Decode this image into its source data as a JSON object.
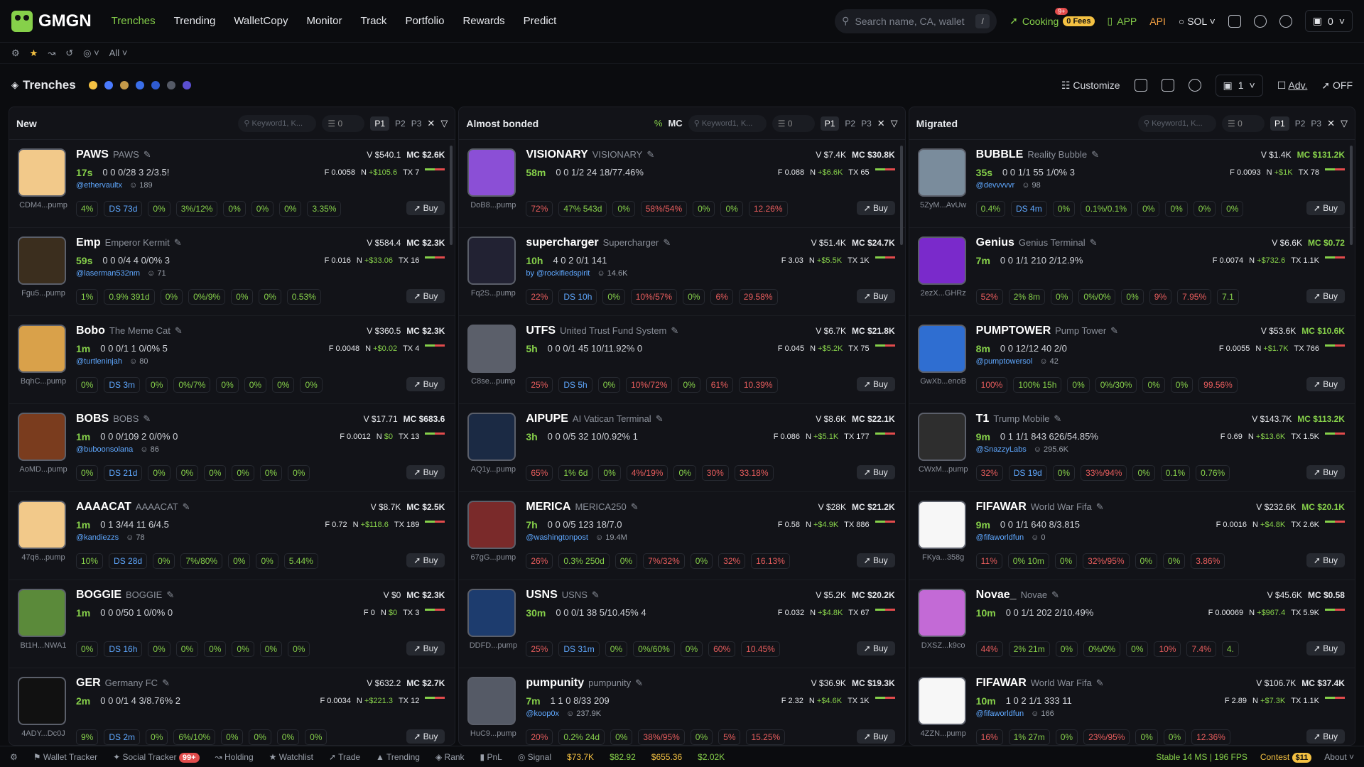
{
  "nav": {
    "brand": "GMGN",
    "items": [
      "Trenches",
      "Trending",
      "WalletCopy",
      "Monitor",
      "Track",
      "Portfolio",
      "Rewards",
      "Predict"
    ],
    "search_placeholder": "Search name, CA, wallet",
    "slash": "/",
    "cooking": "Cooking",
    "cooking_badge": "9+",
    "fees": "0 Fees",
    "app": "APP",
    "api": "API",
    "chain": "SOL",
    "wallet_val": "0"
  },
  "sub": {
    "filter": "All"
  },
  "header": {
    "title": "Trenches",
    "customize": "Customize",
    "count": "1",
    "adv": "Adv.",
    "off": "OFF"
  },
  "columns": [
    {
      "name": "New",
      "pct": "",
      "mc": ""
    },
    {
      "name": "Almost bonded",
      "pct": "%",
      "mc": "MC"
    },
    {
      "name": "Migrated",
      "pct": "",
      "mc": ""
    }
  ],
  "col_common": {
    "keyword": "Keyword1, K...",
    "zero": "0",
    "p1": "P1",
    "p2": "P2",
    "p3": "P3",
    "buy": "Buy"
  },
  "cards": [
    [
      {
        "sym": "PAWS",
        "name": "PAWS",
        "v": "$540.1",
        "mc": "$2.6K",
        "age": "17s",
        "stats": "0  0  0/28  3  2/3.5!",
        "fval": "0.0058",
        "n": "+$105.6",
        "tx": "7",
        "handle": "@ethervaultx",
        "fol": "189",
        "ca": "CDM4...pump",
        "p": [
          "4%",
          "DS 73d",
          "0%",
          "3%/12%",
          "0%",
          "0%",
          "0%",
          "3.35%"
        ]
      },
      {
        "sym": "Emp",
        "name": "Emperor Kermit",
        "v": "$584.4",
        "mc": "$2.3K",
        "age": "59s",
        "stats": "0  0  0/4  4  0/0%  3",
        "fval": "0.016",
        "n": "+$33.06",
        "tx": "16",
        "handle": "@laserman532nm",
        "fol": "71",
        "ca": "Fgu5...pump",
        "p": [
          "1%",
          "0.9% 391d",
          "0%",
          "0%/9%",
          "0%",
          "0%",
          "0.53%",
          ""
        ]
      },
      {
        "sym": "Bobo",
        "name": "The Meme Cat",
        "v": "$360.5",
        "mc": "$2.3K",
        "age": "1m",
        "stats": "0  0  0/1  1  0/0%  5",
        "fval": "0.0048",
        "n": "+$0.02",
        "tx": "4",
        "handle": "@turtleninjah",
        "fol": "80",
        "ca": "BqhC...pump",
        "p": [
          "0%",
          "DS 3m",
          "0%",
          "0%/7%",
          "0%",
          "0%",
          "0%",
          "0%"
        ]
      },
      {
        "sym": "BOBS",
        "name": "BOBS",
        "v": "$17.71",
        "mc": "$683.6",
        "age": "1m",
        "stats": "0  0  0/109  2  0/0%  0",
        "fval": "0.0012",
        "n": "$0",
        "tx": "13",
        "handle": "@buboonsolana",
        "fol": "86",
        "ca": "AoMD...pump",
        "p": [
          "0%",
          "DS 21d",
          "0%",
          "0%",
          "0%",
          "0%",
          "0%",
          "0%"
        ]
      },
      {
        "sym": "AAAACAT",
        "name": "AAAACAT",
        "v": "$8.7K",
        "mc": "$2.5K",
        "age": "1m",
        "stats": "0  1  3/44  11  6/4.5",
        "fval": "0.72",
        "n": "+$118.6",
        "tx": "189",
        "handle": "@kandiezzs",
        "fol": "78",
        "ca": "47q6...pump",
        "p": [
          "10%",
          "DS 28d",
          "0%",
          "7%/80%",
          "0%",
          "0%",
          "5.44%",
          ""
        ]
      },
      {
        "sym": "BOGGIE",
        "name": "BOGGIE",
        "v": "$0",
        "mc": "$2.3K",
        "age": "1m",
        "stats": "0  0  0/50  1  0/0%  0",
        "fval": "0",
        "n": "$0",
        "tx": "3",
        "handle": "",
        "fol": "",
        "ca": "Bt1H...NWA1",
        "p": [
          "0%",
          "DS 16h",
          "0%",
          "0%",
          "0%",
          "0%",
          "0%",
          "0%"
        ]
      },
      {
        "sym": "GER",
        "name": "Germany FC",
        "v": "$632.2",
        "mc": "$2.7K",
        "age": "2m",
        "stats": "0  0  0/1  4  3/8.76%  2",
        "fval": "0.0034",
        "n": "+$221.3",
        "tx": "12",
        "handle": "",
        "fol": "",
        "ca": "4ADY...Dc0J",
        "p": [
          "9%",
          "DS 2m",
          "0%",
          "6%/10%",
          "0%",
          "0%",
          "0%",
          "0%"
        ]
      }
    ],
    [
      {
        "sym": "VISIONARY",
        "name": "VISIONARY",
        "v": "$7.4K",
        "mc": "$30.8K",
        "age": "58m",
        "stats": "0  0  1/2  24  18/77.46%",
        "fval": "0.088",
        "n": "+$6.6K",
        "tx": "65",
        "handle": "",
        "fol": "",
        "ca": "DoB8...pump",
        "p": [
          "72%",
          "47% 543d",
          "0%",
          "58%/54%",
          "0%",
          "0%",
          "12.26%",
          ""
        ]
      },
      {
        "sym": "supercharger",
        "name": "Supercharger",
        "v": "$51.4K",
        "mc": "$24.7K",
        "age": "10h",
        "stats": "4  0  2  0/1  141",
        "fval": "3.03",
        "n": "+$5.5K",
        "tx": "1K",
        "handle": "by @rockifiedspirit",
        "fol": "14.6K",
        "ca": "Fq2S...pump",
        "p": [
          "22%",
          "DS 10h",
          "0%",
          "10%/57%",
          "0%",
          "6%",
          "29.58%",
          ""
        ]
      },
      {
        "sym": "UTFS",
        "name": "United Trust Fund System",
        "v": "$6.7K",
        "mc": "$21.8K",
        "age": "5h",
        "stats": "0  0  0/1  45  10/11.92%  0",
        "fval": "0.045",
        "n": "+$5.2K",
        "tx": "75",
        "handle": "",
        "fol": "",
        "ca": "C8se...pump",
        "p": [
          "25%",
          "DS 5h",
          "0%",
          "10%/72%",
          "0%",
          "61%",
          "10.39%",
          ""
        ]
      },
      {
        "sym": "AIPUPE",
        "name": "AI Vatican Terminal",
        "v": "$8.6K",
        "mc": "$22.1K",
        "age": "3h",
        "stats": "0  0  0/5  32  10/0.92%  1",
        "fval": "0.086",
        "n": "+$5.1K",
        "tx": "177",
        "handle": "",
        "fol": "",
        "ca": "AQ1y...pump",
        "p": [
          "65%",
          "1% 6d",
          "0%",
          "4%/19%",
          "0%",
          "30%",
          "33.18%",
          ""
        ]
      },
      {
        "sym": "MERICA",
        "name": "MERICA250",
        "v": "$28K",
        "mc": "$21.2K",
        "age": "7h",
        "stats": "0  0  0/5  123  18/7.0",
        "fval": "0.58",
        "n": "+$4.9K",
        "tx": "886",
        "handle": "@washingtonpost",
        "fol": "19.4M",
        "ca": "67gG...pump",
        "p": [
          "26%",
          "0.3% 250d",
          "0%",
          "7%/32%",
          "0%",
          "32%",
          "16.13%",
          ""
        ]
      },
      {
        "sym": "USNS",
        "name": "USNS",
        "v": "$5.2K",
        "mc": "$20.2K",
        "age": "30m",
        "stats": "0  0  0/1  38  5/10.45%  4",
        "fval": "0.032",
        "n": "+$4.8K",
        "tx": "67",
        "handle": "",
        "fol": "",
        "ca": "DDFD...pump",
        "p": [
          "25%",
          "DS 31m",
          "0%",
          "0%/60%",
          "0%",
          "60%",
          "10.45%",
          ""
        ]
      },
      {
        "sym": "pumpunity",
        "name": "pumpunity",
        "v": "$36.9K",
        "mc": "$19.3K",
        "age": "7m",
        "stats": "1  1  0  8/33  209",
        "fval": "2.32",
        "n": "+$4.6K",
        "tx": "1K",
        "handle": "@koop0x",
        "fol": "237.9K",
        "ca": "HuC9...pump",
        "p": [
          "20%",
          "0.2% 24d",
          "0%",
          "38%/95%",
          "0%",
          "5%",
          "15.25%",
          ""
        ]
      }
    ],
    [
      {
        "sym": "BUBBLE",
        "name": "Reality Bubble",
        "v": "$1.4K",
        "mc": "$131.2K",
        "age": "35s",
        "stats": "0  0  1/1  55  1/0%  3",
        "fval": "0.0093",
        "n": "+$1K",
        "tx": "78",
        "handle": "@devvvvvr",
        "fol": "98",
        "ca": "5ZyM...AvUw",
        "p": [
          "0.4%",
          "DS 4m",
          "0%",
          "0.1%/0.1%",
          "0%",
          "0%",
          "0%",
          "0%"
        ]
      },
      {
        "sym": "Genius",
        "name": "Genius Terminal",
        "v": "$6.6K",
        "mc": "$0.72",
        "age": "7m",
        "stats": "0  0  1/1  210  2/12.9%",
        "fval": "0.0074",
        "n": "+$732.6",
        "tx": "1.1K",
        "handle": "",
        "fol": "",
        "ca": "2ezX...GHRz",
        "p": [
          "52%",
          "2% 8m",
          "0%",
          "0%/0%",
          "0%",
          "9%",
          "7.95%",
          "7.1"
        ]
      },
      {
        "sym": "PUMPTOWER",
        "name": "Pump Tower",
        "v": "$53.6K",
        "mc": "$10.6K",
        "age": "8m",
        "stats": "0  0  12/12  40  2/0",
        "fval": "0.0055",
        "n": "+$1.7K",
        "tx": "766",
        "handle": "@pumptowersol",
        "fol": "42",
        "ca": "GwXb...enoB",
        "p": [
          "100%",
          "100% 15h",
          "0%",
          "0%/30%",
          "0%",
          "0%",
          "99.56%",
          ""
        ]
      },
      {
        "sym": "T1",
        "name": "Trump Mobile",
        "v": "$143.7K",
        "mc": "$113.2K",
        "age": "9m",
        "stats": "0  1  1/1  843  626/54.85%",
        "fval": "0.69",
        "n": "+$13.6K",
        "tx": "1.5K",
        "handle": "@SnazzyLabs",
        "fol": "295.6K",
        "ca": "CWxM...pump",
        "p": [
          "32%",
          "DS 19d",
          "0%",
          "33%/94%",
          "0%",
          "0.1%",
          "0.76%",
          ""
        ]
      },
      {
        "sym": "FIFAWAR",
        "name": "World War Fifa",
        "v": "$232.6K",
        "mc": "$20.1K",
        "age": "9m",
        "stats": "0  0  1/1  640  8/3.815",
        "fval": "0.0016",
        "n": "+$4.8K",
        "tx": "2.6K",
        "handle": "@fifaworldfun",
        "fol": "0",
        "ca": "FKya...358g",
        "p": [
          "11%",
          "0% 10m",
          "0%",
          "32%/95%",
          "0%",
          "0%",
          "3.86%",
          ""
        ]
      },
      {
        "sym": "Novae_",
        "name": "Novae",
        "v": "$45.6K",
        "mc": "$0.58",
        "age": "10m",
        "stats": "0  0  1/1  202  2/10.49%",
        "fval": "0.00069",
        "n": "+$967.4",
        "tx": "5.9K",
        "handle": "",
        "fol": "",
        "ca": "DXSZ...k9co",
        "p": [
          "44%",
          "2% 21m",
          "0%",
          "0%/0%",
          "0%",
          "10%",
          "7.4%",
          "4."
        ]
      },
      {
        "sym": "FIFAWAR",
        "name": "World War Fifa",
        "v": "$106.7K",
        "mc": "$37.4K",
        "age": "10m",
        "stats": "1  0  2  1/1  333  11",
        "fval": "2.89",
        "n": "+$7.3K",
        "tx": "1.1K",
        "handle": "@fifaworldfun",
        "fol": "166",
        "ca": "4ZZN...pump",
        "p": [
          "16%",
          "1% 27m",
          "0%",
          "23%/95%",
          "0%",
          "0%",
          "12.36%",
          ""
        ]
      }
    ]
  ],
  "footer": {
    "wallet_tracker": "Wallet Tracker",
    "social": "Social Tracker",
    "social_badge": "99+",
    "holding": "Holding",
    "watchlist": "Watchlist",
    "trade": "Trade",
    "trending": "Trending",
    "rank": "Rank",
    "pnl": "PnL",
    "signal": "Signal",
    "btc": "$73.7K",
    "eth": "$82.92",
    "bnb": "$655.36",
    "sol": "$2.02K",
    "stable": "Stable 14 MS | 196 FPS",
    "contest": "Contest",
    "contest_badge": "$11",
    "about": "About"
  }
}
